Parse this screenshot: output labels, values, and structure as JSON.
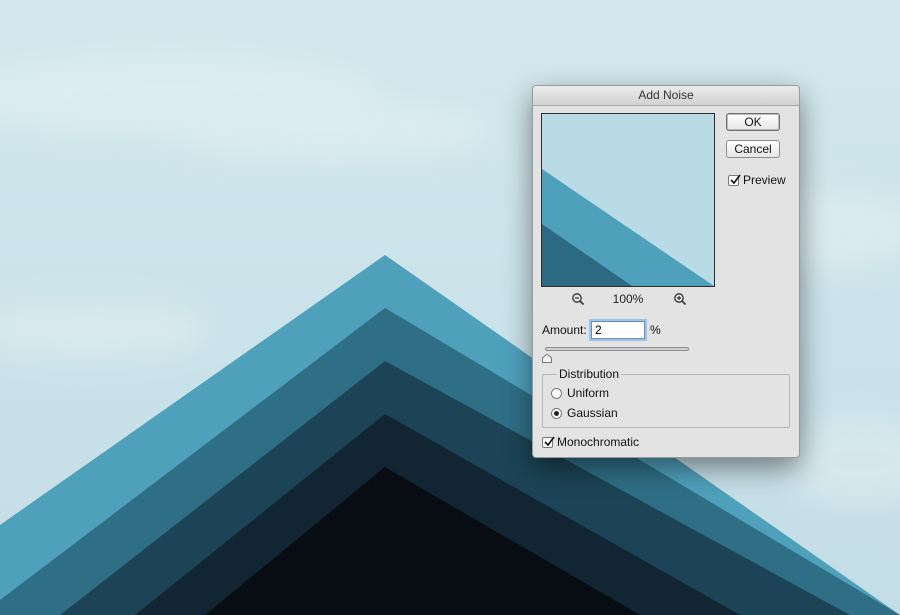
{
  "dialog": {
    "title": "Add Noise",
    "ok_label": "OK",
    "cancel_label": "Cancel",
    "preview_label": "Preview",
    "preview_checked": true,
    "zoom_percent": "100%",
    "zoom_out_icon": "zoom-out-icon",
    "zoom_in_icon": "zoom-in-icon",
    "amount_label": "Amount:",
    "amount_value": "2",
    "amount_unit": "%",
    "amount_slider_fraction": 0.005,
    "distribution_label": "Distribution",
    "distribution_options": [
      "Uniform",
      "Gaussian"
    ],
    "distribution_selected": "Gaussian",
    "monochromatic_label": "Monochromatic",
    "monochromatic_checked": true
  },
  "colors": {
    "sky": "#c9e1e9",
    "stripe_1": "#4fa0bb",
    "stripe_2": "#2f6f86",
    "stripe_3": "#1c4456",
    "stripe_4": "#112632",
    "stripe_5": "#070d12",
    "dialog_bg": "#e3e3e3"
  }
}
